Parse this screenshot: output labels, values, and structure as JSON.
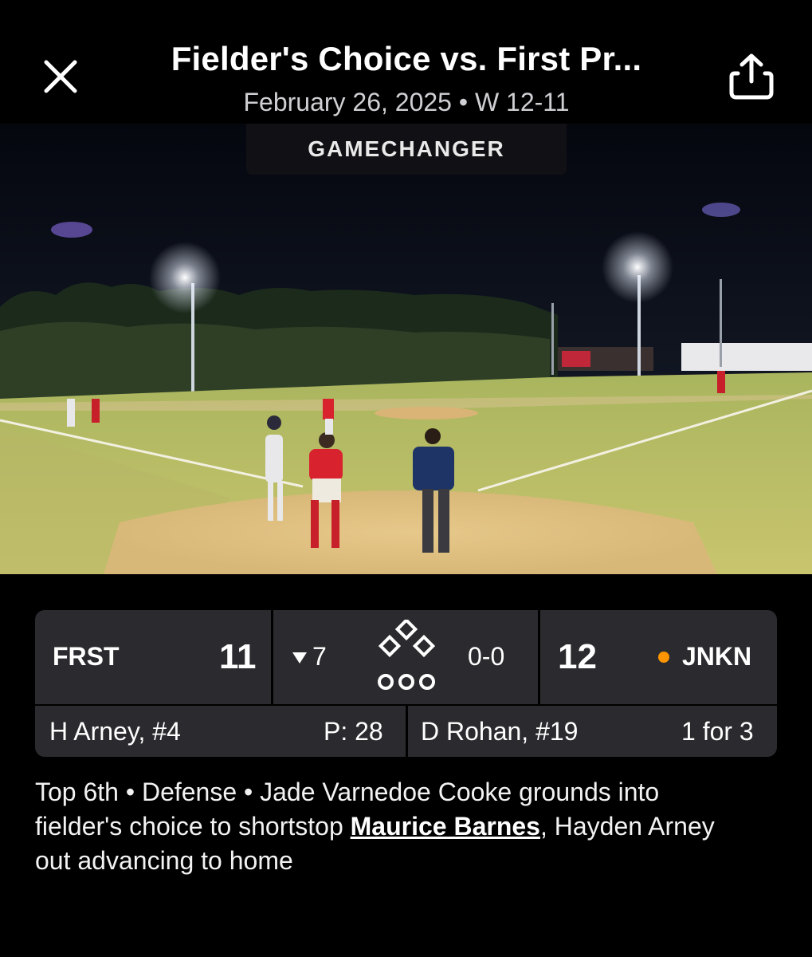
{
  "header": {
    "title": "Fielder's Choice vs. First Pr...",
    "subtitle": "February 26, 2025 • W 12-11"
  },
  "video": {
    "brand": "GAMECHANGER"
  },
  "scoreboard": {
    "away_team": "FRST",
    "away_score": "11",
    "inning": "7",
    "inning_half": "bottom",
    "count": "0-0",
    "outs": 0,
    "home_score": "12",
    "home_team": "JNKN",
    "batting_indicator_color": "#ff9500",
    "pitcher": "H Arney, #4",
    "pitch_count": "P: 28",
    "batter": "D Rohan, #19",
    "batter_stats": "1 for 3"
  },
  "play": {
    "prefix": "Top 6th • Defense • Jade Varnedoe Cooke grounds into fielder's choice to shortstop ",
    "player_link": "Maurice Barnes",
    "suffix": ", Hayden Arney out advancing to home"
  },
  "icons": [
    "close-icon",
    "share-icon",
    "triangle-down-icon",
    "bases-diamond-icon",
    "outs-indicator-icon"
  ]
}
